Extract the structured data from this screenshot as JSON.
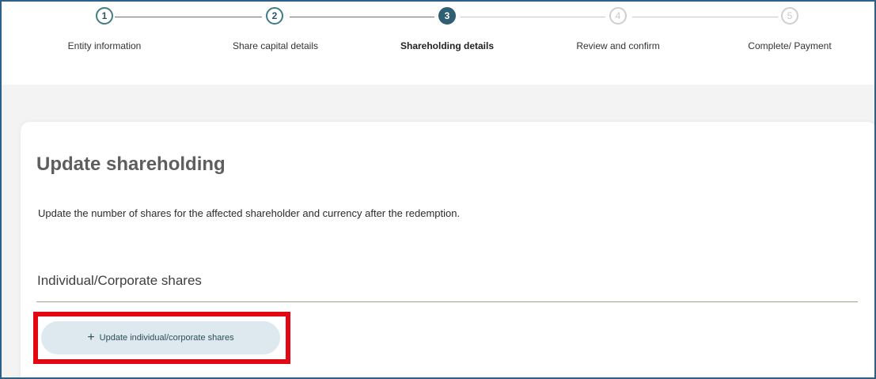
{
  "stepper": {
    "steps": [
      {
        "number": "1",
        "label": "Entity information",
        "state": "completed"
      },
      {
        "number": "2",
        "label": "Share capital details",
        "state": "completed"
      },
      {
        "number": "3",
        "label": "Shareholding details",
        "state": "active"
      },
      {
        "number": "4",
        "label": "Review and confirm",
        "state": "future"
      },
      {
        "number": "5",
        "label": "Complete/ Payment",
        "state": "future"
      }
    ]
  },
  "main": {
    "title": "Update shareholding",
    "description": "Update the number of shares for the affected shareholder and currency after the redemption.",
    "section_title": "Individual/Corporate shares",
    "update_button_label": "Update individual/corporate shares",
    "update_button_icon": "plus-icon"
  },
  "colors": {
    "accent": "#2f5f73",
    "highlight": "#e30613",
    "button_bg": "#dde9ee"
  }
}
